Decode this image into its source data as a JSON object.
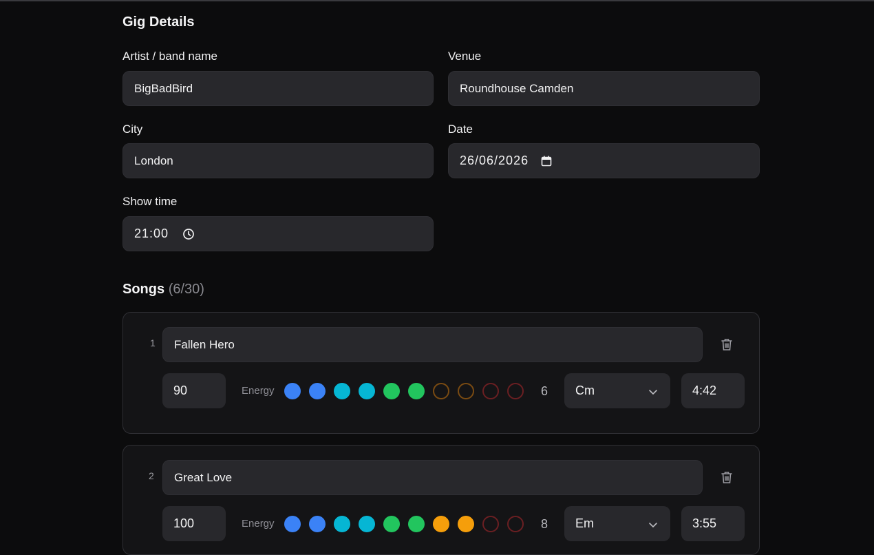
{
  "section_title": "Gig Details",
  "fields": {
    "artist": {
      "label": "Artist / band name",
      "value": "BigBadBird"
    },
    "venue": {
      "label": "Venue",
      "value": "Roundhouse Camden"
    },
    "city": {
      "label": "City",
      "value": "London"
    },
    "date": {
      "label": "Date",
      "value": "26/06/2026"
    },
    "show_time": {
      "label": "Show time",
      "value": "21:00"
    }
  },
  "songs": {
    "title": "Songs",
    "count": "(6/30)",
    "energy_label": "Energy",
    "items": [
      {
        "number": "1",
        "name": "Fallen Hero",
        "bpm": "90",
        "energy": "6",
        "key": "Cm",
        "duration": "4:42"
      },
      {
        "number": "2",
        "name": "Great Love",
        "bpm": "100",
        "energy": "8",
        "key": "Em",
        "duration": "3:55"
      }
    ]
  },
  "colors": {
    "dot_blue": "#3b82f6",
    "dot_cyan": "#06b6d4",
    "dot_green": "#22c55e",
    "dot_orange": "#f59e0b",
    "ring_orange": "#7a4b12",
    "ring_red": "#6b1f22"
  },
  "icons": {
    "calendar": "calendar-icon",
    "clock": "clock-icon",
    "trash": "trash-icon",
    "chevron": "chevron-down-icon"
  }
}
